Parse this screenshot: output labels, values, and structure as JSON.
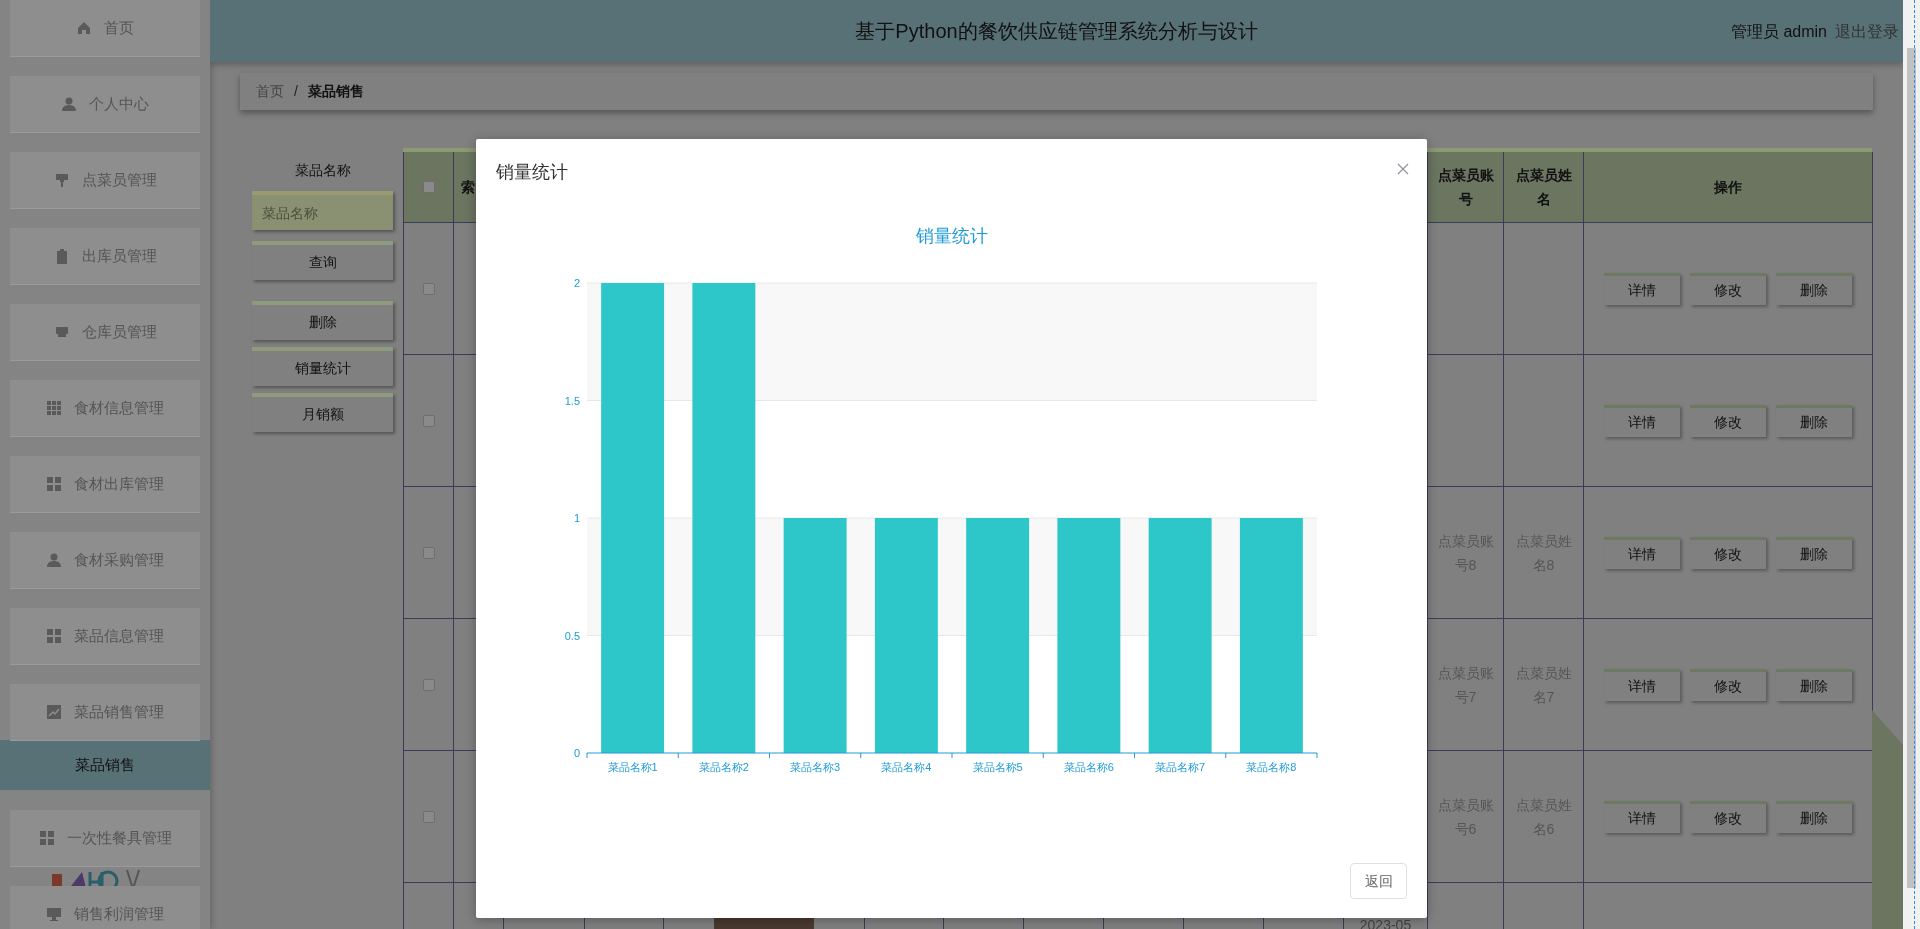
{
  "sidebar": {
    "items": [
      {
        "label": "首页",
        "selected": false
      },
      {
        "label": "个人中心",
        "selected": false
      },
      {
        "label": "点菜员管理",
        "selected": false
      },
      {
        "label": "出库员管理",
        "selected": false
      },
      {
        "label": "仓库员管理",
        "selected": false
      },
      {
        "label": "食材信息管理",
        "selected": false
      },
      {
        "label": "食材出库管理",
        "selected": false
      },
      {
        "label": "食材采购管理",
        "selected": false
      },
      {
        "label": "菜品信息管理",
        "selected": false
      },
      {
        "label": "菜品销售管理",
        "selected": false
      },
      {
        "label": "菜品销售",
        "selected": true
      },
      {
        "label": "一次性餐具管理",
        "selected": false
      },
      {
        "label": "销售利润管理",
        "selected": false
      }
    ]
  },
  "header": {
    "title": "基于Python的餐饮供应链管理系统分析与设计",
    "user": "管理员 admin",
    "logout": "退出登录"
  },
  "breadcrumb": {
    "items": [
      "首页",
      "菜品销售"
    ],
    "separator": "/"
  },
  "search": {
    "label": "菜品名称",
    "placeholder": "菜品名称",
    "buttons": [
      "查询",
      "删除",
      "销量统计",
      "月销额"
    ]
  },
  "table": {
    "select_all_checked": false,
    "columns": [
      {
        "label": "索"
      },
      {
        "label": "点菜员账号"
      },
      {
        "label": "点菜员姓名"
      },
      {
        "label": "操作"
      }
    ],
    "rows": [
      {
        "checked": false,
        "actions": [
          "详情",
          "修改",
          "删除"
        ]
      },
      {
        "checked": false,
        "actions": [
          "详情",
          "修改",
          "删除"
        ]
      },
      {
        "checked": false,
        "account": "点菜员账号8",
        "name": "点菜员姓名8",
        "actions": [
          "详情",
          "修改",
          "删除"
        ]
      },
      {
        "checked": false,
        "account": "点菜员账号7",
        "name": "点菜员姓名7",
        "actions": [
          "详情",
          "修改",
          "删除"
        ]
      },
      {
        "checked": false,
        "account": "点菜员账号6",
        "name": "点菜员姓名6",
        "actions": [
          "详情",
          "修改",
          "删除"
        ]
      },
      {
        "photo": true,
        "date": "2023-05"
      }
    ]
  },
  "modal": {
    "title": "销量统计",
    "chart_data": {
      "type": "bar",
      "title": "销量统计",
      "categories": [
        "菜品名称1",
        "菜品名称2",
        "菜品名称3",
        "菜品名称4",
        "菜品名称5",
        "菜品名称6",
        "菜品名称7",
        "菜品名称8"
      ],
      "series": [
        {
          "color": "#2ec7c9",
          "values": [
            2,
            2,
            1,
            1,
            1,
            1,
            1,
            1
          ]
        }
      ],
      "ylim": [
        0,
        2
      ],
      "yticks": [
        0,
        0.5,
        1,
        1.5,
        2
      ],
      "grid": true
    },
    "close_button": "返回"
  }
}
